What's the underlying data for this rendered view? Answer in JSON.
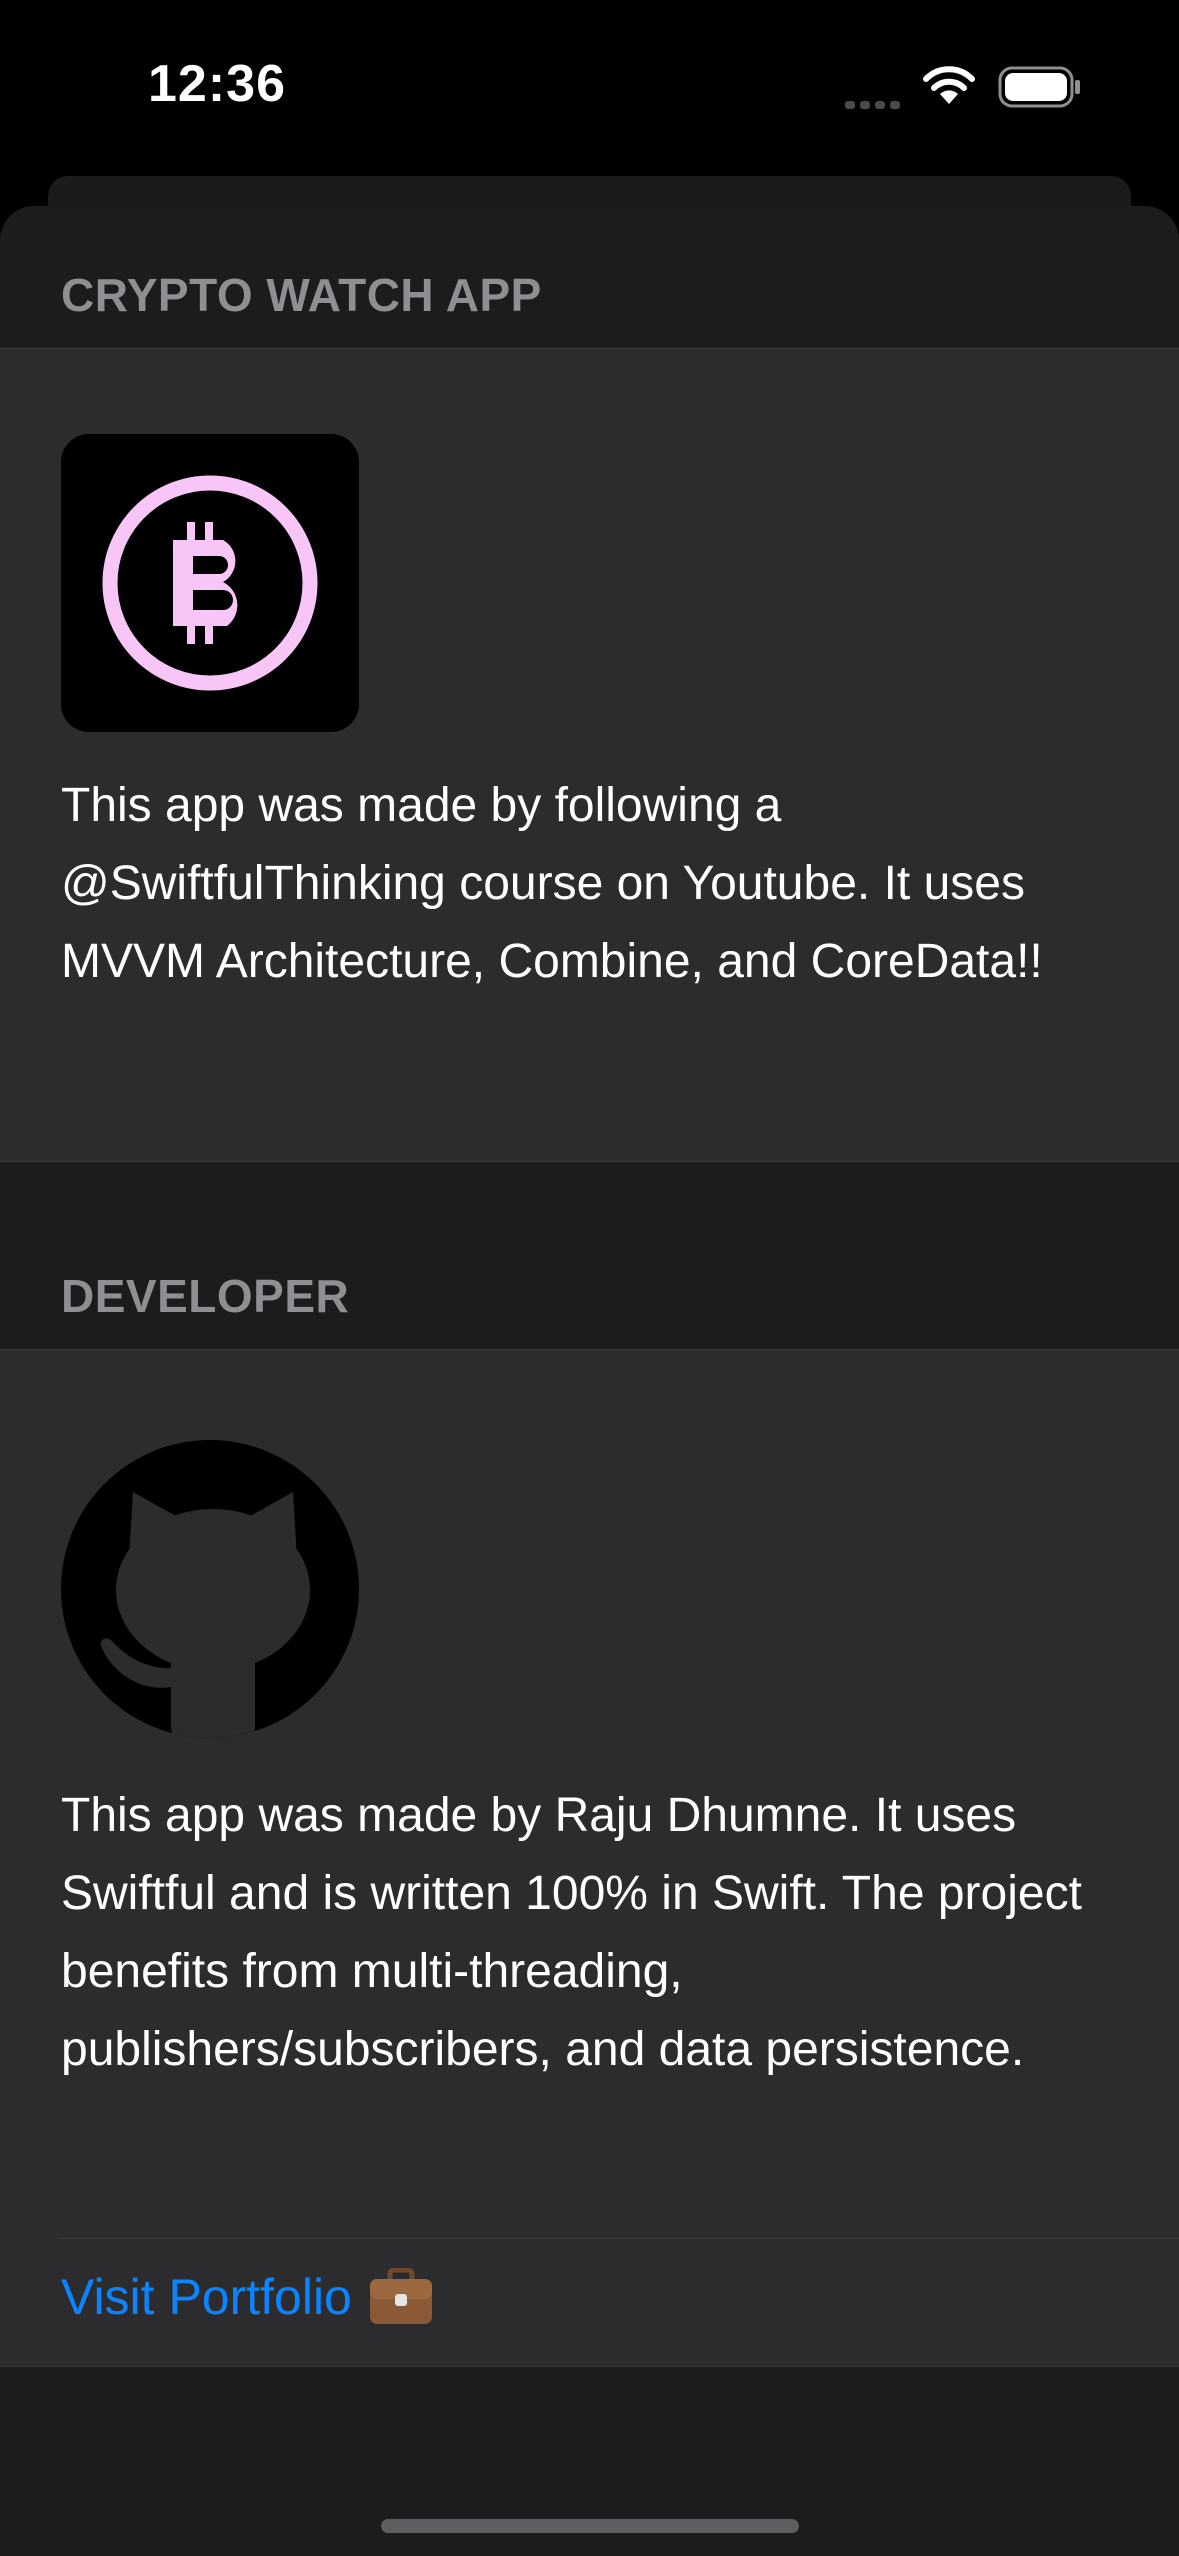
{
  "status_bar": {
    "time": "12:36"
  },
  "sections": {
    "app": {
      "header": "CRYPTO WATCH APP",
      "logo_icon": "bitcoin-icon",
      "logo_color": "#f7c6f7",
      "description": "This app was made by following a @SwiftfulThinking course on Youtube. It uses MVVM Architecture, Combine, and CoreData!!"
    },
    "developer": {
      "header": "DEVELOPER",
      "logo_icon": "github-icon",
      "description": "This app was made by Raju Dhumne. It uses Swiftful and is written 100% in Swift. The project benefits from multi-threading, publishers/subscribers, and data persistence.",
      "link_label": "Visit Portfolio",
      "link_icon": "briefcase-icon",
      "link_color": "#0a84ff"
    }
  }
}
